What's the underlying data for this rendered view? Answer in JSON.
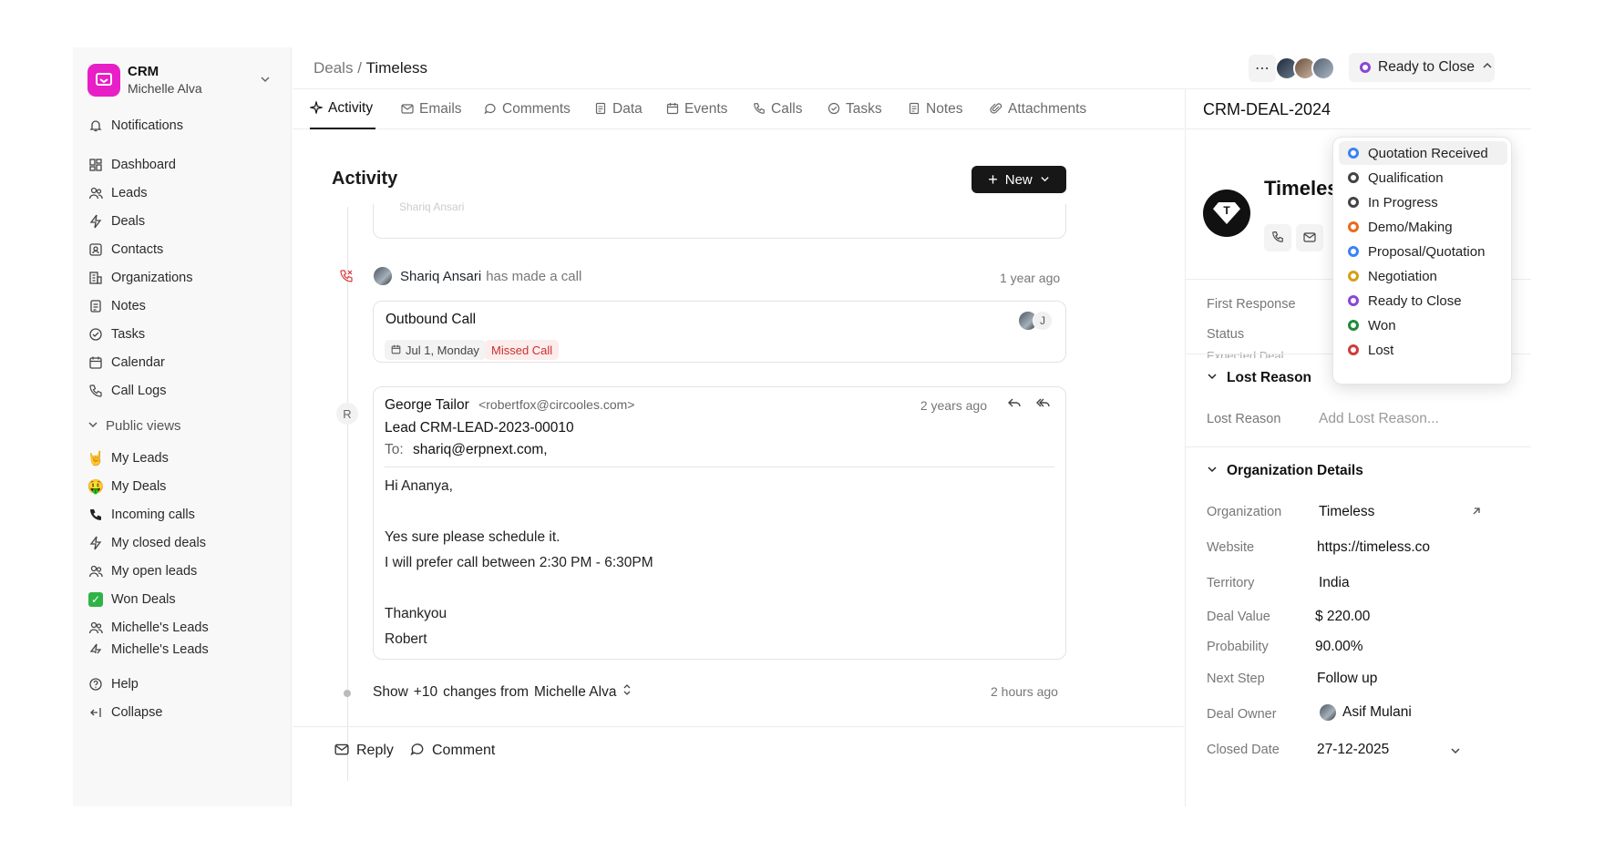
{
  "brand": {
    "name": "CRM",
    "user": "Michelle Alva"
  },
  "sidebar": {
    "notifications": "Notifications",
    "items": [
      "Dashboard",
      "Leads",
      "Deals",
      "Contacts",
      "Organizations",
      "Notes",
      "Tasks",
      "Calendar",
      "Call Logs"
    ],
    "public_views_label": "Public views",
    "views": [
      "My Leads",
      "My Deals",
      "Incoming calls",
      "My closed deals",
      "My open leads",
      "Won Deals",
      "Michelle's Leads",
      "Michelle's Leads"
    ],
    "help": "Help",
    "collapse": "Collapse"
  },
  "header": {
    "breadcrumb_root": "Deals",
    "breadcrumb_sep": "/",
    "breadcrumb_current": "Timeless",
    "status_label": "Ready to Close"
  },
  "tabs": [
    "Activity",
    "Emails",
    "Comments",
    "Data",
    "Events",
    "Calls",
    "Tasks",
    "Notes",
    "Attachments"
  ],
  "activity": {
    "title": "Activity",
    "new_label": "New",
    "faded_text": "Shariq Ansari",
    "call": {
      "actor": "Shariq Ansari",
      "action": "has made a call",
      "time": "1 year ago",
      "title": "Outbound Call",
      "date": "Jul 1, Monday",
      "status": "Missed Call",
      "initial": "J"
    },
    "email": {
      "avatar_initial": "R",
      "from_name": "George Tailor",
      "from_addr": "<robertfox@circooles.com>",
      "time": "2 years ago",
      "subject": "Lead CRM-LEAD-2023-00010",
      "to_label": "To:",
      "to": "shariq@erpnext.com,",
      "body": [
        "Hi Ananya,",
        "Yes sure please schedule it.",
        "I will prefer call between 2:30 PM - 6:30PM",
        "Thankyou",
        "Robert"
      ]
    },
    "changes": {
      "show": "Show",
      "count": "+10",
      "text": "changes from",
      "user": "Michelle Alva",
      "time": "2 hours ago"
    },
    "reply_label": "Reply",
    "comment_label": "Comment"
  },
  "right_panel": {
    "deal_id": "CRM-DEAL-2024",
    "org_name": "Timeless",
    "first_response_label": "First Response",
    "status_label": "Status",
    "expected_label": "Expected Deal...",
    "lost_reason_section": "Lost Reason",
    "lost_reason_label": "Lost Reason",
    "lost_reason_placeholder": "Add Lost Reason...",
    "org_section": "Organization Details",
    "fields": [
      {
        "label": "Organization",
        "value": "Timeless"
      },
      {
        "label": "Website",
        "value": "https://timeless.co"
      },
      {
        "label": "Territory",
        "value": "India"
      },
      {
        "label": "Deal Value",
        "value": "$ 220.00"
      },
      {
        "label": "Probability",
        "value": "90.00%"
      },
      {
        "label": "Next Step",
        "value": "Follow up"
      },
      {
        "label": "Deal Owner",
        "value": "Asif Mulani"
      },
      {
        "label": "Closed Date",
        "value": "27-12-2025"
      }
    ]
  },
  "status_dropdown": {
    "options": [
      {
        "label": "Quotation Received",
        "color": "#3b82f6"
      },
      {
        "label": "Qualification",
        "color": "#444444"
      },
      {
        "label": "In Progress",
        "color": "#444444"
      },
      {
        "label": "Demo/Making",
        "color": "#ea6a1c"
      },
      {
        "label": "Proposal/Quotation",
        "color": "#3b82f6"
      },
      {
        "label": "Negotiation",
        "color": "#d4a017"
      },
      {
        "label": "Ready to Close",
        "color": "#8b46d6"
      },
      {
        "label": "Won",
        "color": "#1f8a3a"
      },
      {
        "label": "Lost",
        "color": "#d23a3a"
      }
    ],
    "selected": "Quotation Received"
  },
  "colors": {
    "brand": "#e81ec6",
    "accent_dark": "#171717",
    "missed": "#c8312d",
    "ready": "#8b46d6"
  }
}
